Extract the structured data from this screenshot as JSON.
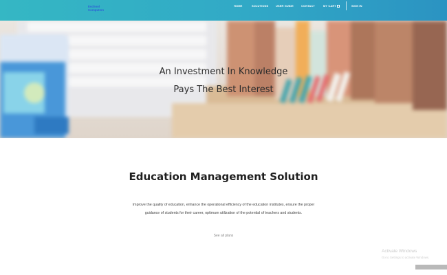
{
  "brand": {
    "logo_line1": "Eschool",
    "logo_line2": "Computers"
  },
  "nav": {
    "items": [
      {
        "label": "HOME"
      },
      {
        "label": "SOLUTIONS"
      },
      {
        "label": "USER GUIDE"
      },
      {
        "label": "CONTACT"
      },
      {
        "label": "MY CART"
      },
      {
        "label": "SIGN IN"
      }
    ]
  },
  "hero": {
    "title_line1": "An Investment In Knowledge",
    "title_line2": "Pays The Best Interest"
  },
  "section": {
    "title": "Education Management Solution",
    "description": "Improve the quality of education, enhance the operational efficiency of the education institutes, ensure the proper guidance of students for their career, optimum utilization of the potential of teachers and students.",
    "cta": "See all plans"
  },
  "watermark": {
    "line1": "Activate Windows",
    "line2": "Go to Settings to activate Windows."
  },
  "colors": {
    "topbar_start": "#35b7c4",
    "topbar_end": "#2b93c2",
    "logo": "#2e5fd6"
  }
}
